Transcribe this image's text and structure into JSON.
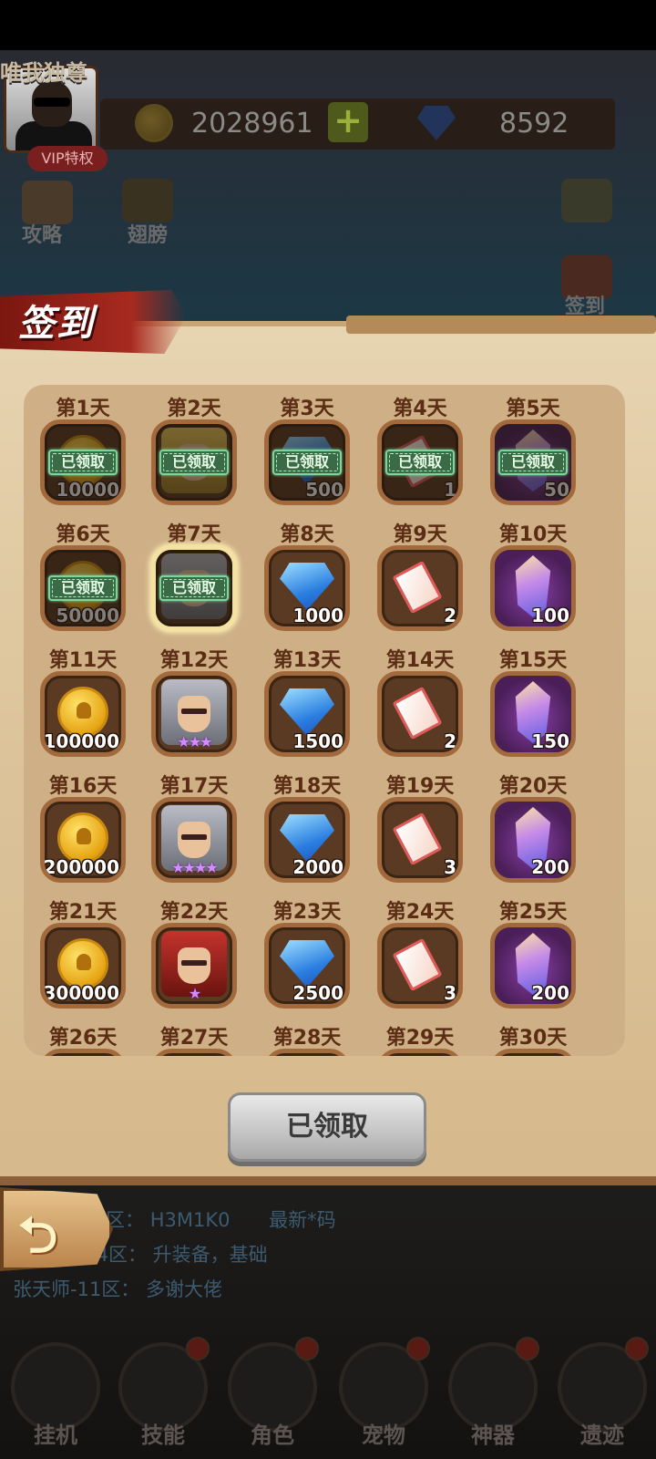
{
  "hud": {
    "player_name": "唯我独尊",
    "vip_label": "VIP特权",
    "coins": "2028961",
    "gems": "8592",
    "side_left": [
      "攻略",
      "翅膀"
    ],
    "side_right": "签到"
  },
  "dialog": {
    "title": "签到",
    "claim_button": "已领取",
    "claimed_badge": "已领取"
  },
  "days": [
    {
      "day": "第1天",
      "reward": "coin",
      "qty": "10000",
      "claimed": true
    },
    {
      "day": "第2天",
      "reward": "hero-blonde",
      "qty": "",
      "claimed": true
    },
    {
      "day": "第3天",
      "reward": "gem",
      "qty": "500",
      "claimed": true
    },
    {
      "day": "第4天",
      "reward": "ticket",
      "qty": "1",
      "claimed": true
    },
    {
      "day": "第5天",
      "reward": "crystal",
      "qty": "50",
      "claimed": true
    },
    {
      "day": "第6天",
      "reward": "coin",
      "qty": "50000",
      "claimed": true
    },
    {
      "day": "第7天",
      "reward": "hero",
      "qty": "",
      "claimed": true,
      "today": true
    },
    {
      "day": "第8天",
      "reward": "gem",
      "qty": "1000",
      "claimed": false
    },
    {
      "day": "第9天",
      "reward": "ticket",
      "qty": "2",
      "claimed": false
    },
    {
      "day": "第10天",
      "reward": "crystal",
      "qty": "100",
      "claimed": false
    },
    {
      "day": "第11天",
      "reward": "coin",
      "qty": "100000",
      "claimed": false
    },
    {
      "day": "第12天",
      "reward": "hero",
      "qty": "",
      "stars": "★★★",
      "claimed": false
    },
    {
      "day": "第13天",
      "reward": "gem",
      "qty": "1500",
      "claimed": false
    },
    {
      "day": "第14天",
      "reward": "ticket",
      "qty": "2",
      "claimed": false
    },
    {
      "day": "第15天",
      "reward": "crystal",
      "qty": "150",
      "claimed": false
    },
    {
      "day": "第16天",
      "reward": "coin",
      "qty": "200000",
      "claimed": false
    },
    {
      "day": "第17天",
      "reward": "hero",
      "qty": "",
      "stars": "★★★★",
      "claimed": false
    },
    {
      "day": "第18天",
      "reward": "gem",
      "qty": "2000",
      "claimed": false
    },
    {
      "day": "第19天",
      "reward": "ticket",
      "qty": "3",
      "claimed": false
    },
    {
      "day": "第20天",
      "reward": "crystal",
      "qty": "200",
      "claimed": false
    },
    {
      "day": "第21天",
      "reward": "coin",
      "qty": "300000",
      "claimed": false
    },
    {
      "day": "第22天",
      "reward": "hero-red",
      "qty": "",
      "stars": "★",
      "claimed": false
    },
    {
      "day": "第23天",
      "reward": "gem",
      "qty": "2500",
      "claimed": false
    },
    {
      "day": "第24天",
      "reward": "ticket",
      "qty": "3",
      "claimed": false
    },
    {
      "day": "第25天",
      "reward": "crystal",
      "qty": "200",
      "claimed": false
    },
    {
      "day": "第26天",
      "reward": "",
      "qty": "",
      "claimed": false
    },
    {
      "day": "第27天",
      "reward": "",
      "qty": "",
      "claimed": false
    },
    {
      "day": "第28天",
      "reward": "",
      "qty": "",
      "claimed": false
    },
    {
      "day": "第29天",
      "reward": "",
      "qty": "",
      "claimed": false
    },
    {
      "day": "第30天",
      "reward": "",
      "qty": "",
      "claimed": false
    }
  ],
  "chat": [
    {
      "server": "区：",
      "msg": "H3M1K0",
      "extra": "最新*码"
    },
    {
      "server": "胖东励神-4区：",
      "msg": "升装备，基础",
      "extra": ""
    },
    {
      "server": "张天师-11区：",
      "msg": "多谢大佬",
      "extra": ""
    }
  ],
  "nav": [
    "挂机",
    "技能",
    "角色",
    "宠物",
    "神器",
    "遗迹"
  ],
  "colors": {
    "accent": "#a82a1f",
    "parchment": "#dcc39a",
    "claimed_green": "#7ad69a"
  }
}
